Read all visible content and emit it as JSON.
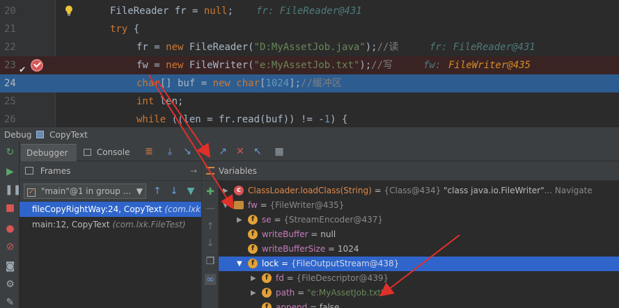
{
  "editor": {
    "lines": [
      {
        "num": "20",
        "code_html": "<span class='id'>FileReader fr = </span><span class='kw'>null</span><span class='id'>;</span>",
        "inline": "fr: FileReader@431"
      },
      {
        "num": "21",
        "code_html": "<span class='kw'>try</span><span class='id'> {</span>",
        "inline": ""
      },
      {
        "num": "22",
        "code_html": "<span class='id'>fr = </span><span class='kw'>new </span><span class='id'>FileReader(</span><span class='str'>\"D:MyAssetJob.java\"</span><span class='id'>);</span><span class='cm'>//读</span>",
        "inline": "fr: FileReader@431"
      },
      {
        "num": "23",
        "code_html": "<span class='id'>fw = </span><span class='kw'>new </span><span class='id'>FileWriter(</span><span class='str'>\"e:MyAssetJob.txt\"</span><span class='id'>);</span><span class='cm'>//写</span>",
        "inline_label": "fw: ",
        "inline_value": "FileWriter@435"
      },
      {
        "num": "24",
        "code_html": "<span class='kw'>char</span><span class='id'>[] buf = </span><span class='kw'>new char</span><span class='id'>[</span><span class='num-lit'>1024</span><span class='id'>];</span><span class='cm'>//缓冲区</span>",
        "inline": ""
      },
      {
        "num": "25",
        "code_html": "<span class='kw'>int </span><span class='id'>len;</span>",
        "inline": ""
      },
      {
        "num": "26",
        "code_html": "<span class='kw'>while </span><span class='id'>((len = fr.read(buf)) != -</span><span class='num-lit'>1</span><span class='id'>) {</span>",
        "inline": ""
      }
    ]
  },
  "debug": {
    "title": "Debug",
    "config": "CopyText",
    "tabs": {
      "debugger": "Debugger",
      "console": "Console"
    }
  },
  "frames": {
    "title": "Frames",
    "thread": "\"main\"@1 in group ...",
    "items": [
      {
        "method": "fileCopyRightWay:24, CopyText ",
        "pkg": "(com.lxk.File",
        "selected": true
      },
      {
        "method": "main:12, CopyText ",
        "pkg": "(com.lxk.FileTest)",
        "selected": false
      }
    ]
  },
  "variables": {
    "title": "Variables",
    "rows": [
      {
        "name": "ClassLoader.loadClass(String)",
        "eq": " = ",
        "type": "{Class@434} ",
        "value": "\"class java.io.FileWriter\"",
        "nav": "... Navigate"
      },
      {
        "name": "fw",
        "eq": " = ",
        "type": "{FileWriter@435}"
      },
      {
        "name": "se",
        "eq": " = ",
        "type": "{StreamEncoder@437}"
      },
      {
        "name": "writeBuffer",
        "eq": " = ",
        "value": "null"
      },
      {
        "name": "writeBufferSize",
        "eq": " = ",
        "value": "1024"
      },
      {
        "name": "lock",
        "eq": " = ",
        "type": "{FileOutputStream@438}"
      },
      {
        "name": "fd",
        "eq": " = ",
        "type": "{FileDescriptor@439}"
      },
      {
        "name": "path",
        "eq": " = ",
        "value": "\"e:MyAssetJob.txt\""
      },
      {
        "name": "append",
        "eq": " = ",
        "value": "false"
      }
    ]
  },
  "colors": {
    "keyword": "#cc7832",
    "string": "#6a8759",
    "selection": "#2f65ca",
    "breakpoint": "#d65656",
    "annotation_arrow": "#e0302a"
  }
}
